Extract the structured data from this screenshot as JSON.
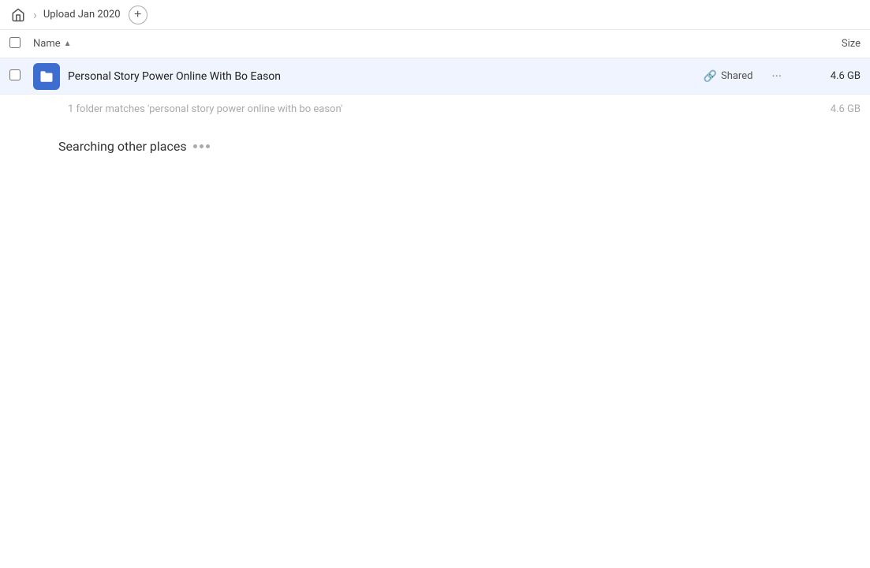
{
  "header": {
    "home_icon": "home-icon",
    "breadcrumb_label": "Upload Jan 2020",
    "add_button_label": "+"
  },
  "columns": {
    "name_label": "Name",
    "sort_arrow": "▲",
    "size_label": "Size"
  },
  "file_row": {
    "name": "Personal Story Power Online With Bo Eason",
    "shared_label": "Shared",
    "size": "4.6 GB",
    "icon_type": "folder"
  },
  "match_row": {
    "text": "1 folder matches 'personal story power online with bo eason'",
    "size": "4.6 GB"
  },
  "searching": {
    "label": "Searching other places"
  }
}
